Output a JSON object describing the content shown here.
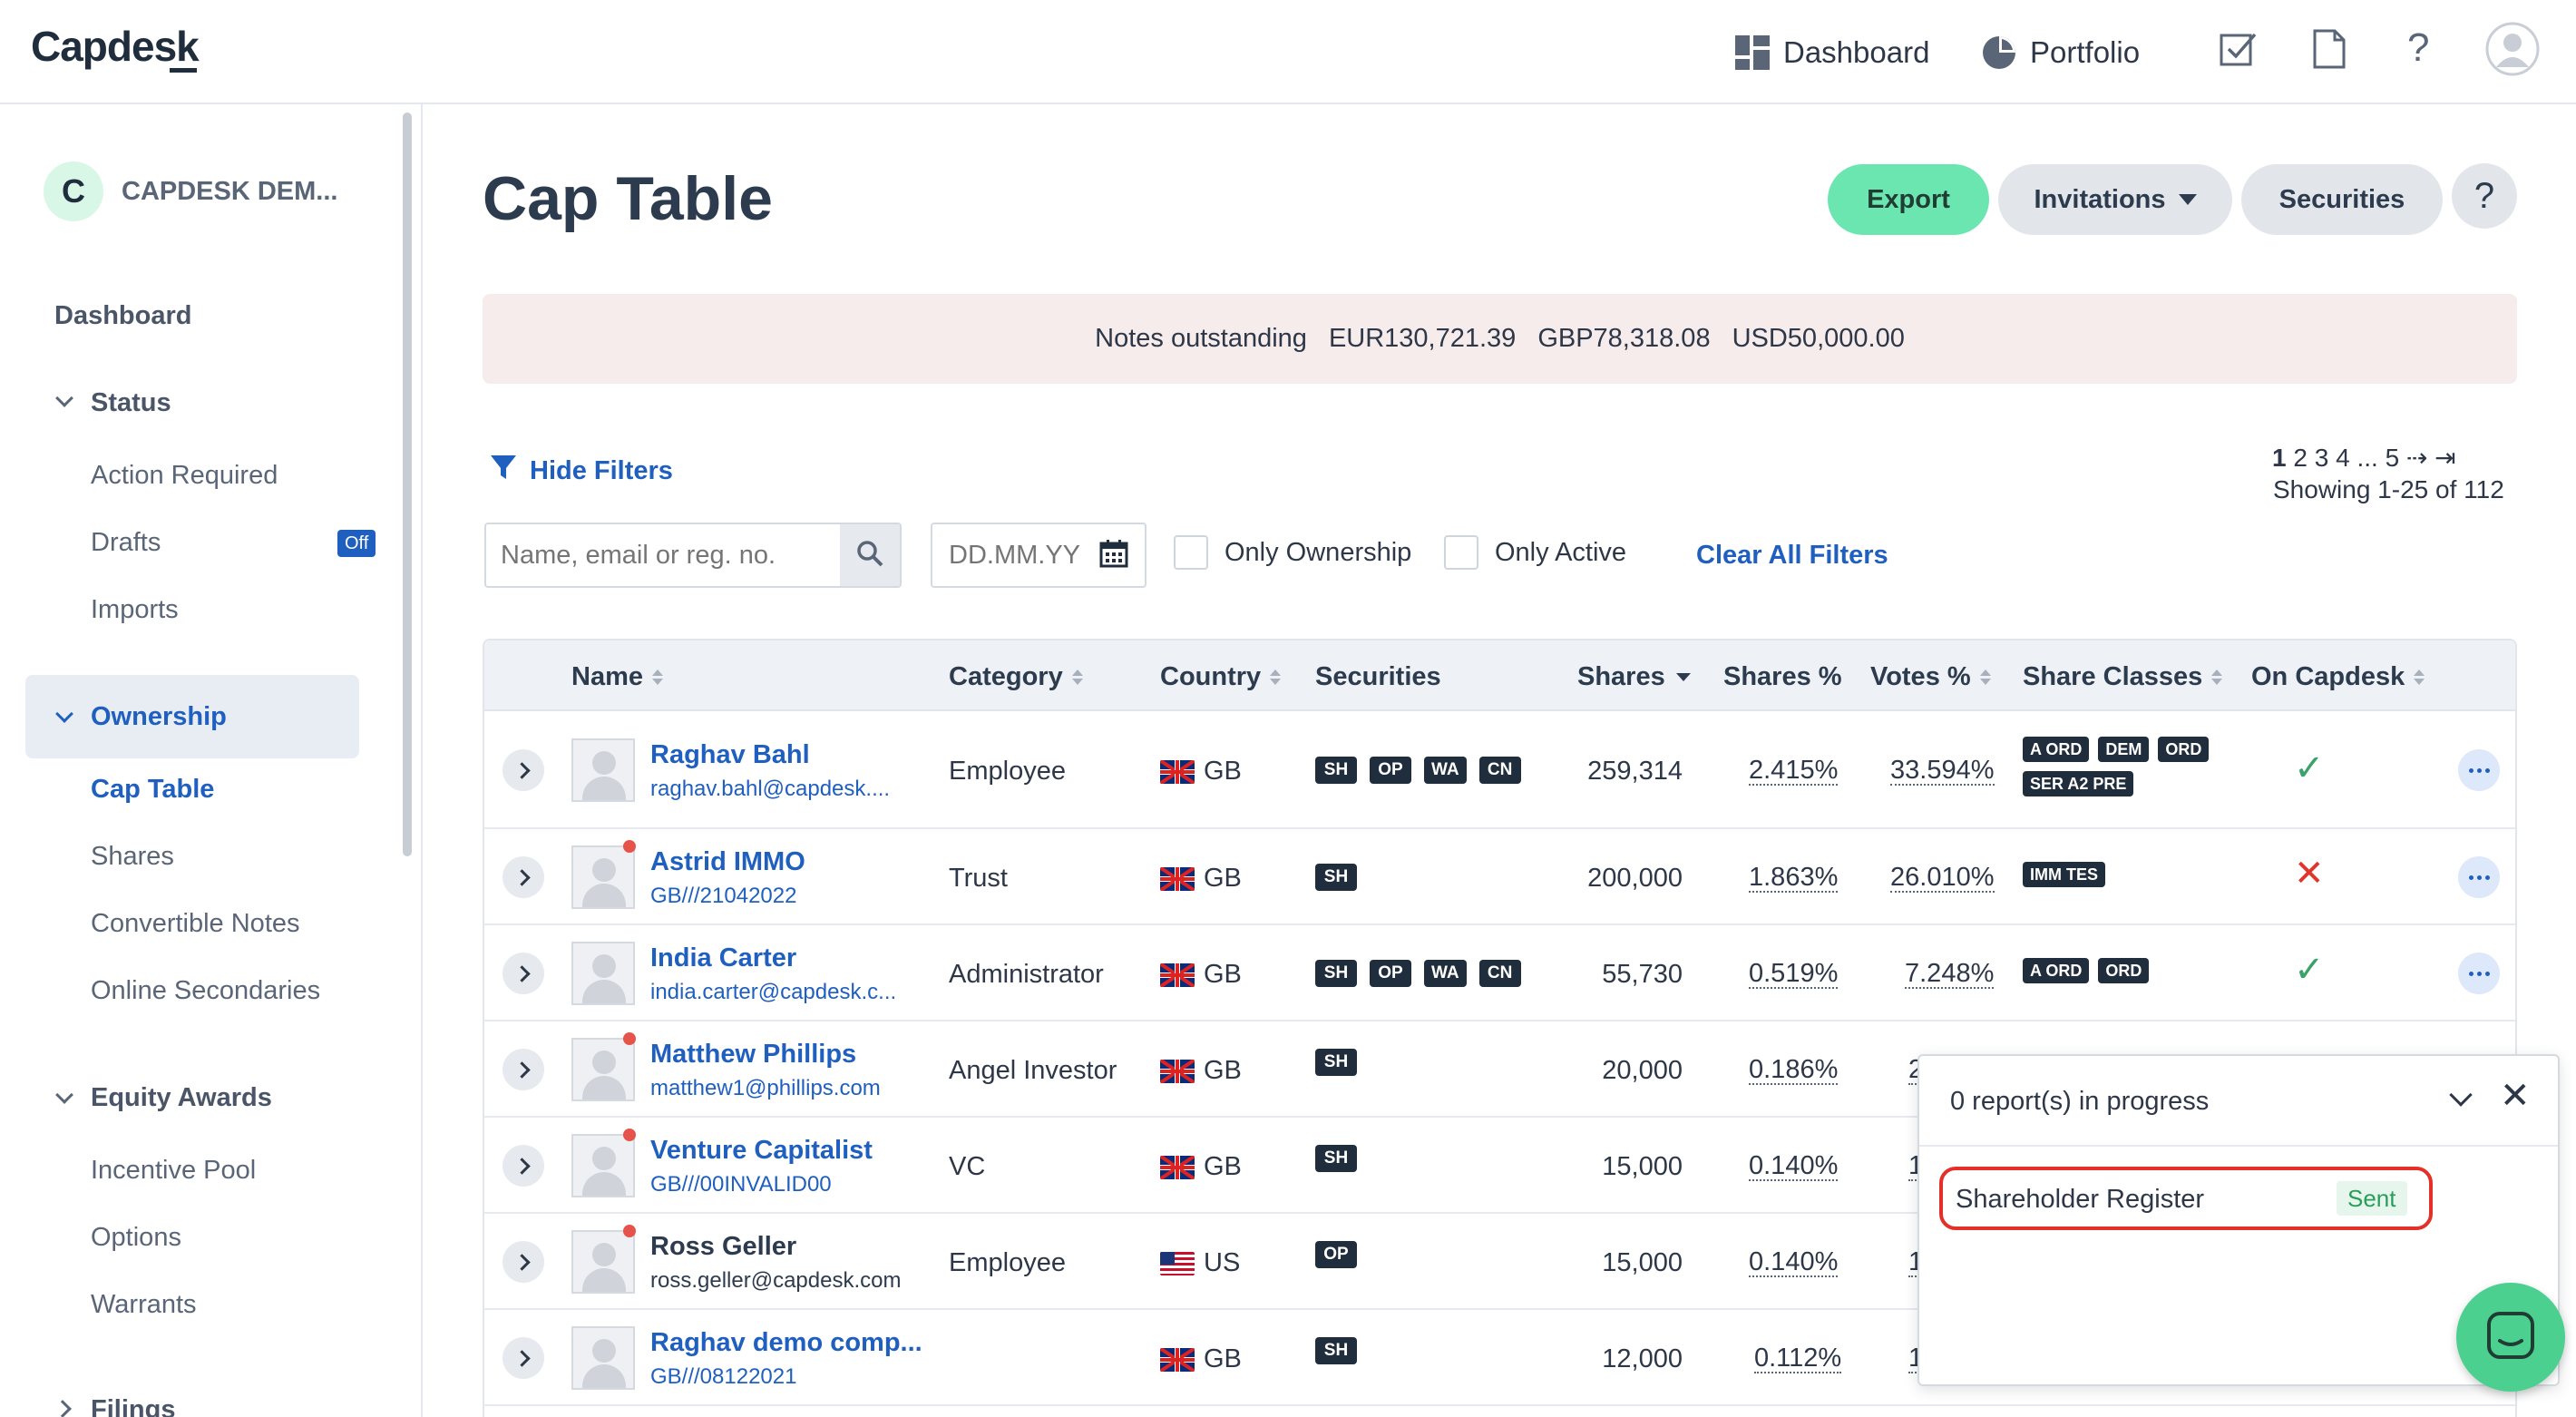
{
  "app": {
    "logo": "Capdesk"
  },
  "topnav": {
    "dashboard_label": "Dashboard",
    "portfolio_label": "Portfolio"
  },
  "sidebar": {
    "company_initial": "C",
    "company_name": "CAPDESK DEM...",
    "dashboard": "Dashboard",
    "status_heading": "Status",
    "action_required": "Action Required",
    "drafts": "Drafts",
    "drafts_badge": "Off",
    "imports": "Imports",
    "ownership_heading": "Ownership",
    "cap_table": "Cap Table",
    "shares": "Shares",
    "convertible_notes": "Convertible Notes",
    "online_secondaries": "Online Secondaries",
    "equity_awards_heading": "Equity Awards",
    "incentive_pool": "Incentive Pool",
    "options": "Options",
    "warrants": "Warrants",
    "filings_heading": "Filings"
  },
  "page": {
    "title": "Cap Table",
    "export_label": "Export",
    "invitations_label": "Invitations",
    "securities_label": "Securities",
    "help_label": "?"
  },
  "notes": {
    "label": "Notes outstanding",
    "eur": "EUR130,721.39",
    "gbp": "GBP78,318.08",
    "usd": "USD50,000.00"
  },
  "filters": {
    "hide_label": "Hide Filters",
    "search_placeholder": "Name, email or reg. no.",
    "date_placeholder": "DD.MM.YY",
    "only_ownership": "Only Ownership",
    "only_active": "Only Active",
    "clear_all": "Clear All Filters"
  },
  "pagination": {
    "pages": [
      "1",
      "2",
      "3",
      "4",
      "...",
      "5"
    ],
    "next": "⇢",
    "last": "⇥",
    "showing": "Showing 1-25 of 112"
  },
  "table": {
    "headers": {
      "name": "Name",
      "category": "Category",
      "country": "Country",
      "securities": "Securities",
      "shares": "Shares",
      "shares_pct": "Shares %",
      "votes_pct": "Votes %",
      "share_classes": "Share Classes",
      "on_capdesk": "On Capdesk"
    },
    "rows": [
      {
        "name": "Raghav Bahl",
        "sub": "raghav.bahl@capdesk....",
        "category": "Employee",
        "country": "GB",
        "securities": [
          "SH",
          "OP",
          "WA",
          "CN"
        ],
        "shares": "259,314",
        "shares_pct": "2.415%",
        "votes_pct": "33.594%",
        "classes": [
          "A ORD",
          "DEM",
          "ORD",
          "SER A2 PRE"
        ],
        "on_capdesk": "✓"
      },
      {
        "name": "Astrid IMMO",
        "sub": "GB///21042022",
        "category": "Trust",
        "country": "GB",
        "securities": [
          "SH"
        ],
        "shares": "200,000",
        "shares_pct": "1.863%",
        "votes_pct": "26.010%",
        "classes": [
          "IMM TES"
        ],
        "on_capdesk": "✕"
      },
      {
        "name": "India Carter",
        "sub": "india.carter@capdesk.c...",
        "category": "Administrator",
        "country": "GB",
        "securities": [
          "SH",
          "OP",
          "WA",
          "CN"
        ],
        "shares": "55,730",
        "shares_pct": "0.519%",
        "votes_pct": "7.248%",
        "classes": [
          "A ORD",
          "ORD"
        ],
        "on_capdesk": "✓"
      },
      {
        "name": "Matthew Phillips",
        "sub": "matthew1@phillips.com",
        "category": "Angel Investor",
        "country": "GB",
        "securities": [
          "SH"
        ],
        "shares": "20,000",
        "shares_pct": "0.186%",
        "votes_pct": "2",
        "classes": [],
        "on_capdesk": ""
      },
      {
        "name": "Venture Capitalist",
        "sub": "GB///00INVALID00",
        "category": "VC",
        "country": "GB",
        "securities": [
          "SH"
        ],
        "shares": "15,000",
        "shares_pct": "0.140%",
        "votes_pct": "1",
        "classes": [],
        "on_capdesk": ""
      },
      {
        "name": "Ross Geller",
        "sub": "ross.geller@capdesk.com",
        "category": "Employee",
        "country": "US",
        "securities": [
          "OP"
        ],
        "shares": "15,000",
        "shares_pct": "0.140%",
        "votes_pct": "1",
        "classes": [],
        "on_capdesk": ""
      },
      {
        "name": "Raghav demo comp...",
        "sub": "GB///08122021",
        "category": "",
        "country": "GB",
        "securities": [
          "SH"
        ],
        "shares": "12,000",
        "shares_pct": "0.112%",
        "votes_pct": "1",
        "classes": [],
        "on_capdesk": ""
      }
    ]
  },
  "reports": {
    "title": "0 report(s) in progress",
    "item_name": "Shareholder Register",
    "item_status": "Sent"
  },
  "colors": {
    "accent": "#1f5fbf",
    "export": "#6ce6b0",
    "banner": "#f6eceb",
    "danger": "#e5302a",
    "success": "#3aa36a",
    "chat": "#4cd08f"
  }
}
